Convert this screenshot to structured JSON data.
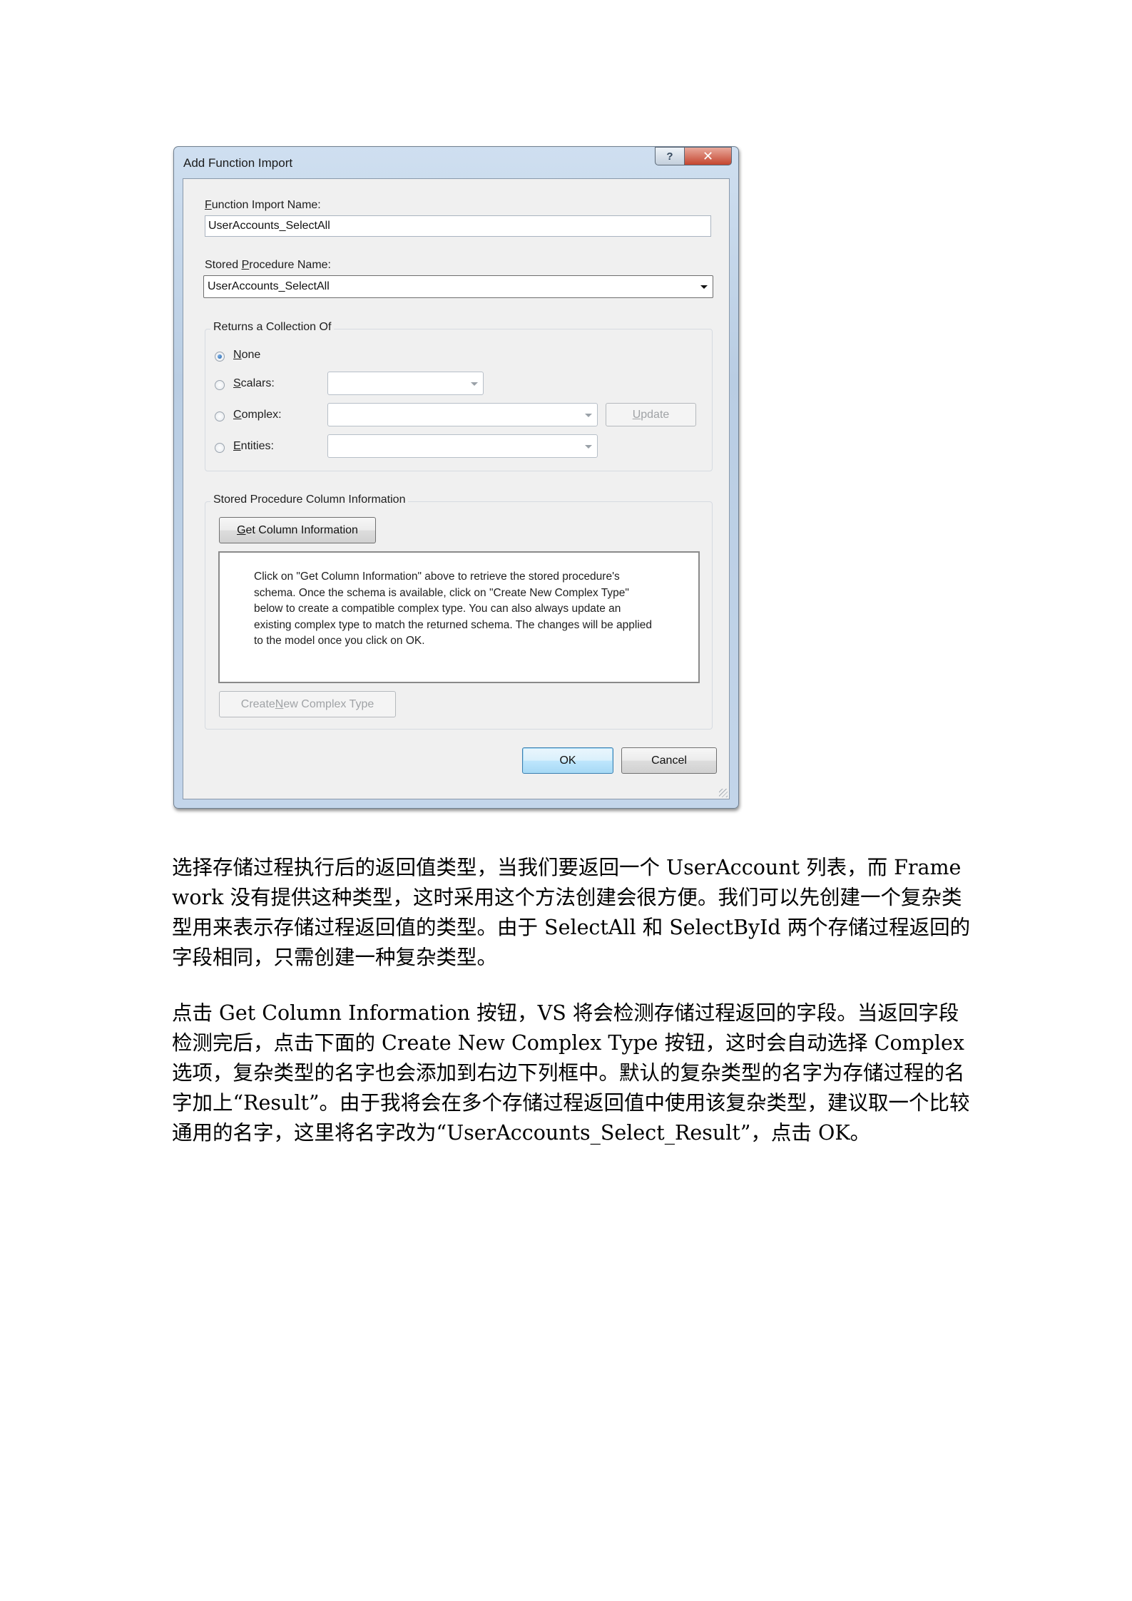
{
  "dialog": {
    "title": "Add Function Import",
    "help_glyph": "?",
    "close_glyph": "✕",
    "function_import_label_ul": "F",
    "function_import_label_rest": "unction Import Name:",
    "function_import_value": "UserAccounts_SelectAll",
    "stored_proc_label_pre": "Stored ",
    "stored_proc_label_ul": "P",
    "stored_proc_label_rest": "rocedure Name:",
    "stored_proc_value": "UserAccounts_SelectAll",
    "returns_group_title": "Returns a Collection Of",
    "options": {
      "none_ul": "N",
      "none_rest": "one",
      "scalars_ul": "S",
      "scalars_rest": "calars:",
      "complex_ul": "C",
      "complex_rest": "omplex:",
      "entities_ul": "E",
      "entities_rest": "ntities:",
      "selected": "None"
    },
    "update_ul": "U",
    "update_rest": "pdate",
    "column_group_title": "Stored Procedure Column Information",
    "get_column_ul": "G",
    "get_column_rest": "et Column Information",
    "info_text": "Click on \"Get Column Information\" above to retrieve the stored procedure's schema. Once the schema is available, click on \"Create New Complex Type\" below to create a compatible complex type. You can also always update an existing complex type to match the returned schema. The changes will be applied to the model once you click on OK.",
    "create_pre": "Create ",
    "create_ul": "N",
    "create_rest": "ew Complex Type",
    "ok_label": "OK",
    "cancel_label": "Cancel"
  },
  "paragraphs": [
    "选择存储过程执行后的返回值类型，当我们要返回一个 UserAccount 列表，而 Framework 没有提供这种类型，这时采用这个方法创建会很方便。我们可以先创建一个复杂类型用来表示存储过程返回值的类型。由于 SelectAll 和 SelectById 两个存储过程返回的字段相同，只需创建一种复杂类型。",
    "点击 Get Column Information 按钮，VS 将会检测存储过程返回的字段。当返回字段检测完后，点击下面的 Create New Complex Type 按钮，这时会自动选择 Complex 选项，复杂类型的名字也会添加到右边下列框中。默认的复杂类型的名字为存储过程的名字加上“Result”。由于我将会在多个存储过程返回值中使用该复杂类型，建议取一个比较通用的名字，这里将名字改为“UserAccounts_Select_Result”，点击 OK。"
  ]
}
